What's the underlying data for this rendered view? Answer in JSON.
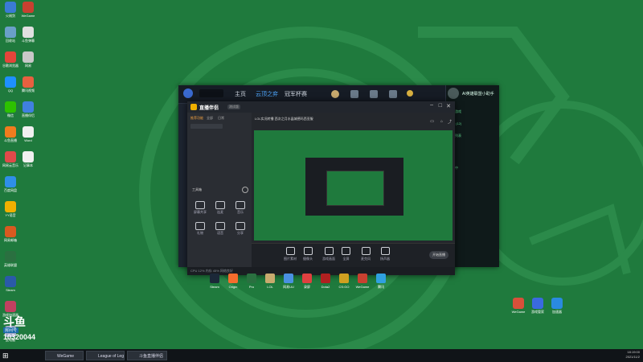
{
  "desktop": {
    "left_icons": [
      {
        "label": "火绒剑",
        "icon": "app-icon",
        "color": "#3a7bd5"
      },
      {
        "label": "回收站",
        "icon": "recycle-bin-icon",
        "color": "#6aa0c8"
      },
      {
        "label": "谷歌浏览器",
        "icon": "chrome-icon",
        "color": "#e4453a"
      },
      {
        "label": "QQ",
        "icon": "qq-icon",
        "color": "#1e90ff"
      },
      {
        "label": "微信",
        "icon": "wechat-icon",
        "color": "#2dc100"
      },
      {
        "label": "斗鱼直播",
        "icon": "douyu-icon",
        "color": "#f07c1e"
      },
      {
        "label": "网易云音乐",
        "icon": "music-icon",
        "color": "#e04a4a"
      },
      {
        "label": "百度网盘",
        "icon": "cloud-icon",
        "color": "#2f8fe8"
      },
      {
        "label": "YY语音",
        "icon": "yy-icon",
        "color": "#f0b000"
      },
      {
        "label": "网易邮箱",
        "icon": "mail-icon",
        "color": "#d85a20"
      },
      {
        "label": "英雄联盟",
        "icon": "lol-icon",
        "color": "#2a7040"
      },
      {
        "label": "Steam",
        "icon": "steam-icon",
        "color": "#2a5aa8"
      },
      {
        "label": "游戏加速器",
        "icon": "game-icon",
        "color": "#c04060"
      },
      {
        "label": "此电脑",
        "icon": "computer-icon",
        "color": "#a0a8c8"
      }
    ],
    "right_col_icons": [
      {
        "label": "WeGame",
        "icon": "wegame-icon",
        "color": "#c84030"
      },
      {
        "label": "斗鱼弹幕",
        "icon": "chat-icon",
        "color": "#e0e0e0"
      },
      {
        "label": "网易",
        "icon": "netease-icon",
        "color": "#c8c8c8"
      },
      {
        "label": "腾讯视频",
        "icon": "video-icon",
        "color": "#e86040"
      },
      {
        "label": "直播伴侣",
        "icon": "live-icon",
        "color": "#4080e0"
      },
      {
        "label": "Word",
        "icon": "document-icon",
        "color": "#f0f0f0"
      },
      {
        "label": "记事本",
        "icon": "note-icon",
        "color": "#f0f0f0"
      }
    ],
    "lower_right_icons": [
      {
        "label": "WeGame",
        "icon": "wegame-icon",
        "color": "#d8503a"
      },
      {
        "label": "游戏管家",
        "icon": "shield-icon",
        "color": "#3a6ae0"
      },
      {
        "label": "加速器",
        "icon": "speed-icon",
        "color": "#2a8ae0"
      }
    ]
  },
  "client": {
    "tabs": [
      {
        "label": "主页"
      },
      {
        "label": "云顶之弈"
      },
      {
        "label": "冠军杯赛"
      }
    ],
    "chat_lines": [
      "AI英雄联盟小助手",
      "最近游戏",
      "在线 (12)",
      "好友列表",
      "分组",
      "游戏中",
      "离线",
      "设置"
    ]
  },
  "studio": {
    "brand": "直播伴侣",
    "version": "测试版",
    "title": "LOL实况转播 西次之月水晶城德玛西亚服",
    "left_tabs": [
      "推荐功能",
      "全部",
      "日常"
    ],
    "tools_header": "工具箱",
    "tools": [
      {
        "label": "屏幕共享",
        "icon": "screen-icon"
      },
      {
        "label": "连麦",
        "icon": "mic-icon"
      },
      {
        "label": "音乐",
        "icon": "music-icon"
      },
      {
        "label": "礼物",
        "icon": "gift-icon"
      },
      {
        "label": "语音",
        "icon": "voice-icon"
      },
      {
        "label": "分享",
        "icon": "share-icon"
      }
    ],
    "bottom_tools": [
      {
        "label": "图片素材",
        "icon": "image-icon"
      },
      {
        "label": "摄像头",
        "icon": "camera-icon"
      },
      {
        "label": "游戏画面",
        "icon": "game-icon"
      },
      {
        "label": "全屏",
        "icon": "fullscreen-icon"
      },
      {
        "label": "麦克风",
        "icon": "mic-icon"
      },
      {
        "label": "扬声器",
        "icon": "speaker-icon"
      }
    ],
    "start_button": "开始直播",
    "status": "CPU 12%  内存 45%  网络良好"
  },
  "dock_apps": [
    {
      "label": "Steam",
      "icon": "steam-icon",
      "color": "#1b2838"
    },
    {
      "label": "Origin",
      "icon": "origin-icon",
      "color": "#f56c2d"
    },
    {
      "label": "Pro",
      "icon": "pro-icon",
      "color": "#2a7040"
    },
    {
      "label": "LOL",
      "icon": "lol-icon",
      "color": "#c8aa6e"
    },
    {
      "label": "网易UU",
      "icon": "uu-icon",
      "color": "#4a90e2"
    },
    {
      "label": "录屏",
      "icon": "record-icon",
      "color": "#e04040"
    },
    {
      "label": "Dota2",
      "icon": "dota-icon",
      "color": "#b02020"
    },
    {
      "label": "CS:GO",
      "icon": "csgo-icon",
      "color": "#d0a020"
    },
    {
      "label": "WeGame",
      "icon": "wegame-icon",
      "color": "#c84030"
    },
    {
      "label": "腾讯",
      "icon": "tencent-icon",
      "color": "#30a0e0"
    }
  ],
  "overlay": {
    "brand": "斗鱼",
    "sub": "房间号",
    "room": "10320044"
  },
  "taskbar": {
    "items": [
      {
        "label": "WeGame"
      },
      {
        "label": "League of Legends"
      },
      {
        "label": "斗鱼直播伴侣"
      }
    ],
    "time": "18:19:00",
    "date": "2021/11/2"
  }
}
